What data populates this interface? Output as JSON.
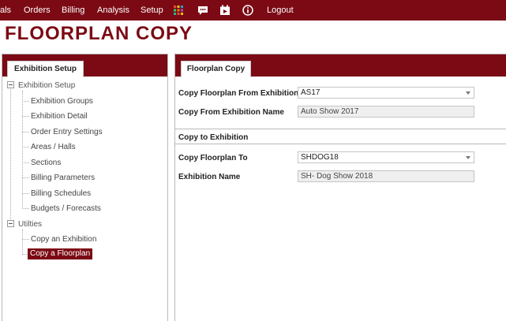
{
  "topnav": {
    "items": [
      {
        "label": "als"
      },
      {
        "label": "Orders"
      },
      {
        "label": "Billing"
      },
      {
        "label": "Analysis"
      },
      {
        "label": "Setup"
      }
    ],
    "icons": [
      "apps-grid-icon",
      "chat-icon",
      "calendar-icon",
      "info-icon"
    ],
    "logout_label": "Logout"
  },
  "page": {
    "title": "FLOORPLAN COPY"
  },
  "left_panel": {
    "tab_label": "Exhibition Setup",
    "tree": {
      "root1": "Exhibition Setup",
      "root1_children": [
        "Exhibition Groups",
        "Exhibition Detail",
        "Order Entry Settings",
        "Areas / Halls",
        "Sections",
        "Billing Parameters",
        "Billing Schedules",
        "Budgets / Forecasts"
      ],
      "root2": "Utilties",
      "root2_children": [
        "Copy an Exhibition",
        "Copy a Floorplan"
      ],
      "selected": "Copy a Floorplan"
    }
  },
  "right_panel": {
    "tab_label": "Floorplan Copy",
    "copy_from": {
      "id_label": "Copy Floorplan From Exhibition ID",
      "id_value": "AS17",
      "name_label": "Copy From Exhibition Name",
      "name_value": "Auto Show 2017"
    },
    "copy_to": {
      "section_title": "Copy to Exhibition",
      "to_label": "Copy Floorplan To",
      "to_value": "SHDOG18",
      "name_label": "Exhibition Name",
      "name_value": "SH- Dog Show 2018"
    }
  },
  "colors": {
    "brand": "#7b0a14",
    "field_border": "#c4c4c4",
    "readonly_bg": "#efefef"
  }
}
